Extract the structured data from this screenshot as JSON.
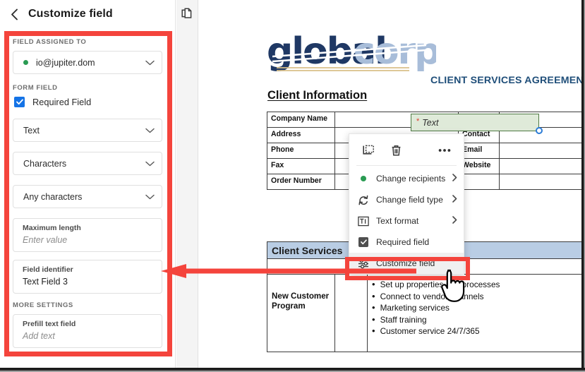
{
  "sidebar": {
    "back_icon": "chevron-left-icon",
    "title": "Customize field",
    "assigned_section_label": "FIELD ASSIGNED TO",
    "assignee": {
      "status_dot_color": "#2a9b53",
      "value": "io@jupiter.dom",
      "chevron_icon": "chevron-down-icon"
    },
    "form_field_section_label": "FORM FIELD",
    "required_field": {
      "label": "Required Field",
      "checked": true,
      "checkbox_color": "#1473e6"
    },
    "selects": [
      {
        "value": "Text",
        "icon": "chevron-down-icon"
      },
      {
        "value": "Characters",
        "icon": "chevron-down-icon"
      },
      {
        "value": "Any characters",
        "icon": "chevron-down-icon"
      }
    ],
    "max_length": {
      "label": "Maximum length",
      "placeholder": "Enter value",
      "value": ""
    },
    "field_identifier": {
      "label": "Field identifier",
      "value": "Text Field 3"
    },
    "more_settings_label": "MORE SETTINGS",
    "prefill": {
      "label": "Prefill text field",
      "placeholder": "Add text",
      "value": ""
    }
  },
  "tool_rail": {
    "icons": [
      {
        "name": "pages-thumbnail-icon"
      }
    ]
  },
  "document": {
    "logo": {
      "part1": "global",
      "part2": "corp",
      "part1_color": "#1f3864",
      "part2_color": "#a8bdd9"
    },
    "agreement_title": "CLIENT SERVICES AGREEMENT",
    "client_info_heading": "Client Information",
    "table_rows": [
      {
        "label": "Company Name",
        "value": "",
        "label2": "",
        "value2": ""
      },
      {
        "label": "Address",
        "value": "",
        "label2": "Contact",
        "value2": ""
      },
      {
        "label": "Phone",
        "value": "",
        "label2": "Email",
        "value2": ""
      },
      {
        "label": "Fax",
        "value": "",
        "label2": "Website",
        "value2": ""
      },
      {
        "label": "Order Number",
        "value": "",
        "label2": "",
        "value2": ""
      }
    ],
    "active_field": {
      "required_marker": "*",
      "placeholder": "Text"
    },
    "services_heading": "Client Services",
    "services_row_label": "New Customer Program",
    "services_bullets": [
      "Set up properties and processes",
      "Connect to vendor channels",
      "Marketing services",
      "Staff training",
      "Customer service 24/7/365"
    ]
  },
  "context_menu": {
    "toolbar_icons": [
      {
        "name": "duplicate-icon"
      },
      {
        "name": "delete-icon"
      },
      {
        "name": "more-options-icon"
      }
    ],
    "items": [
      {
        "label": "Change recipients",
        "icon": "recipient-dot-icon",
        "submenu": true,
        "highlighted": false
      },
      {
        "label": "Change field type",
        "icon": "change-field-type-icon",
        "submenu": true,
        "highlighted": false
      },
      {
        "label": "Text format",
        "icon": "text-format-icon",
        "submenu": true,
        "highlighted": false
      },
      {
        "label": "Required field",
        "icon": "checkbox-checked-icon",
        "submenu": false,
        "highlighted": false
      },
      {
        "label": "Customize field",
        "icon": "sliders-icon",
        "submenu": false,
        "highlighted": true
      }
    ]
  },
  "annotation": {
    "color": "#f4443c",
    "arrow_direction": "left"
  }
}
